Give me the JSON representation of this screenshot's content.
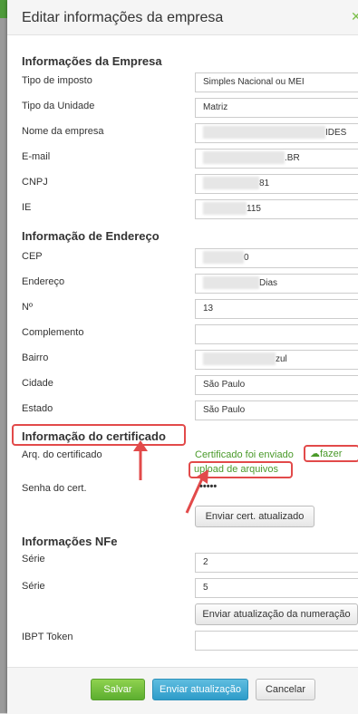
{
  "modal": {
    "title": "Editar informações da empresa"
  },
  "sections": {
    "empresa": "Informações da Empresa",
    "endereco": "Informação de Endereço",
    "certificado": "Informação do certificado",
    "nfe": "Informações NFe"
  },
  "fields": {
    "tipo_imposto": {
      "label": "Tipo de imposto",
      "value": "Simples Nacional ou MEI"
    },
    "tipo_unidade": {
      "label": "Tipo da Unidade",
      "value": "Matriz"
    },
    "nome_empresa": {
      "label": "Nome da empresa",
      "value": "IDES"
    },
    "email": {
      "label": "E-mail",
      "value": ".BR"
    },
    "cnpj": {
      "label": "CNPJ",
      "value": "81"
    },
    "ie": {
      "label": "IE",
      "value": "115"
    },
    "cep": {
      "label": "CEP",
      "value": "0"
    },
    "endereco": {
      "label": "Endereço",
      "value": "Dias"
    },
    "numero": {
      "label": "Nº",
      "value": "13"
    },
    "complemento": {
      "label": "Complemento",
      "value": ""
    },
    "bairro": {
      "label": "Bairro",
      "value": "zul"
    },
    "cidade": {
      "label": "Cidade",
      "value": "São Paulo"
    },
    "estado": {
      "label": "Estado",
      "value": "São Paulo"
    },
    "arq_cert": {
      "label": "Arq. do certificado"
    },
    "senha_cert": {
      "label": "Senha do cert.",
      "value": "•••••"
    },
    "serie1": {
      "label": "Série",
      "value": "2"
    },
    "serie2": {
      "label": "Série",
      "value": "5"
    },
    "ibpt": {
      "label": "IBPT Token",
      "value": ""
    }
  },
  "certificado": {
    "status": "Certificado foi enviado",
    "upload_a": "fazer",
    "upload_b": "upload de arquivos"
  },
  "buttons": {
    "enviar_cert": "Enviar cert. atualizado",
    "enviar_numeracao": "Enviar atualização da numeração",
    "salvar": "Salvar",
    "enviar_atualizacao": "Enviar atualização",
    "cancelar": "Cancelar"
  },
  "colors": {
    "accent_green": "#5cae2f",
    "accent_blue": "#2e9cc9",
    "annotation_red": "#e24a4a",
    "link_green": "#4a9a2a"
  },
  "icons": {
    "upload": "cloud-upload-icon",
    "close": "close-icon"
  }
}
